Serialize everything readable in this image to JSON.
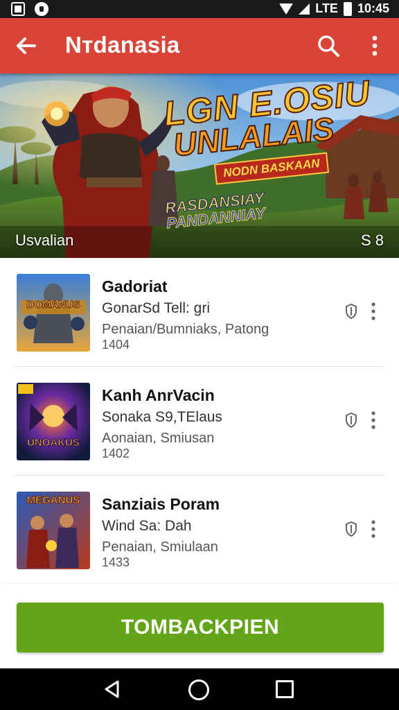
{
  "status_bar": {
    "network_label": "LTE",
    "time": "10:45"
  },
  "app_bar": {
    "title": "Nтdanasia"
  },
  "banner": {
    "title_line1": "LGN E.OSIU",
    "title_line2": "UNLALAIS",
    "ribbon": "NODN BASKAAN",
    "subtitle_line1": "RASDANSIAY",
    "subtitle_line2": "PANDANNIAY",
    "caption": "Usvalian",
    "count": "S 8"
  },
  "apps": [
    {
      "title": "Gadoriat",
      "developer": "GonarSd Tell: gri",
      "category": "Penaian/Bumniaks, Patong",
      "size": "1404",
      "thumb_text": "DOMANUS"
    },
    {
      "title": "Kanh AnrVacin",
      "developer": "Sonaka S9,TElaus",
      "category": "Aonaian, Smiusan",
      "size": "1402",
      "thumb_text": "UNOAKUS"
    },
    {
      "title": "Sanziais Poram",
      "developer": "Wind Sa: Dah",
      "category": "Penaian, Smiulaan",
      "size": "1433",
      "thumb_text": "MEGANUS"
    }
  ],
  "cta": {
    "label": "TOMBACKPIEN"
  },
  "colors": {
    "app_bar": "#d94437",
    "cta": "#63a518",
    "status_bar": "#1a1a1a",
    "nav_bar": "#000000"
  },
  "icons": {
    "back": "arrow-left-icon",
    "search": "search-icon",
    "more": "more-vert-icon",
    "shield": "shield-icon",
    "nav_back": "triangle-back-icon",
    "nav_home": "circle-home-icon",
    "nav_recent": "square-recent-icon"
  }
}
